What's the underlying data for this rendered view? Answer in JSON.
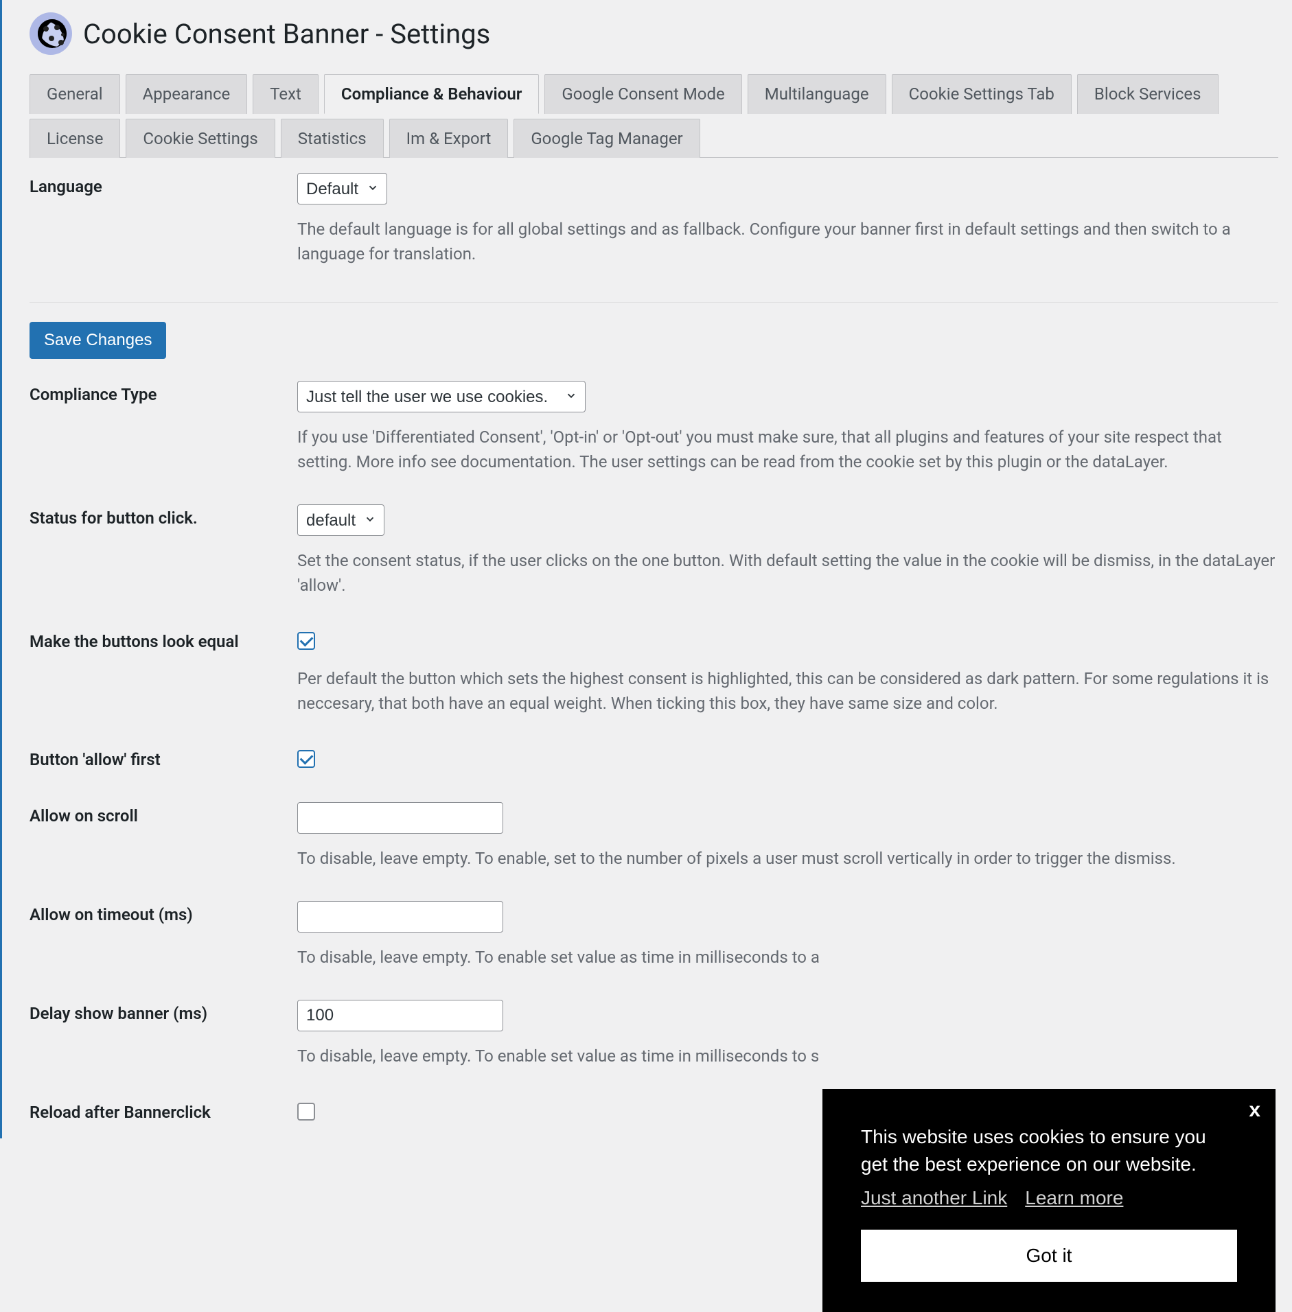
{
  "page": {
    "title": "Cookie Consent Banner - Settings"
  },
  "tabs": [
    {
      "label": "General",
      "active": false
    },
    {
      "label": "Appearance",
      "active": false
    },
    {
      "label": "Text",
      "active": false
    },
    {
      "label": "Compliance & Behaviour",
      "active": true
    },
    {
      "label": "Google Consent Mode",
      "active": false
    },
    {
      "label": "Multilanguage",
      "active": false
    },
    {
      "label": "Cookie Settings Tab",
      "active": false
    },
    {
      "label": "Block Services",
      "active": false
    },
    {
      "label": "License",
      "active": false
    },
    {
      "label": "Cookie Settings",
      "active": false
    },
    {
      "label": "Statistics",
      "active": false
    },
    {
      "label": "Im & Export",
      "active": false
    },
    {
      "label": "Google Tag Manager",
      "active": false
    }
  ],
  "save_button": "Save Changes",
  "fields": {
    "language": {
      "label": "Language",
      "value": "Default",
      "description": "The default language is for all global settings and as fallback. Configure your banner first in default settings and then switch to a language for translation."
    },
    "compliance_type": {
      "label": "Compliance Type",
      "value": "Just tell the user we use cookies.",
      "description": "If you use 'Differentiated Consent', 'Opt-in' or 'Opt-out' you must make sure, that all plugins and features of your site respect that setting. More info see documentation. The user settings can be read from the cookie set by this plugin or the dataLayer."
    },
    "status_button_click": {
      "label": "Status for button click.",
      "value": "default",
      "description": "Set the consent status, if the user clicks on the one button. With default setting the value in the cookie will be dismiss, in the dataLayer 'allow'."
    },
    "buttons_equal": {
      "label": "Make the buttons look equal",
      "checked": true,
      "description": "Per default the button which sets the highest consent is highlighted, this can be considered as dark pattern. For some regulations it is neccesary, that both have an equal weight. When ticking this box, they have same size and color."
    },
    "allow_first": {
      "label": "Button 'allow' first",
      "checked": true
    },
    "allow_on_scroll": {
      "label": "Allow on scroll",
      "value": "",
      "description": "To disable, leave empty. To enable, set to the number of pixels a user must scroll vertically in order to trigger the dismiss."
    },
    "allow_on_timeout": {
      "label": "Allow on timeout (ms)",
      "value": "",
      "description": "To disable, leave empty. To enable set value as time in milliseconds to a"
    },
    "delay_show": {
      "label": "Delay show banner (ms)",
      "value": "100",
      "description": "To disable, leave empty. To enable set value as time in milliseconds to s"
    },
    "reload_after": {
      "label": "Reload after Bannerclick",
      "checked": false
    }
  },
  "cookie_banner": {
    "close": "x",
    "text": "This website uses cookies to ensure you get the best experience on our website.",
    "link1": "Just another Link",
    "link2": "Learn more",
    "button": "Got it"
  }
}
